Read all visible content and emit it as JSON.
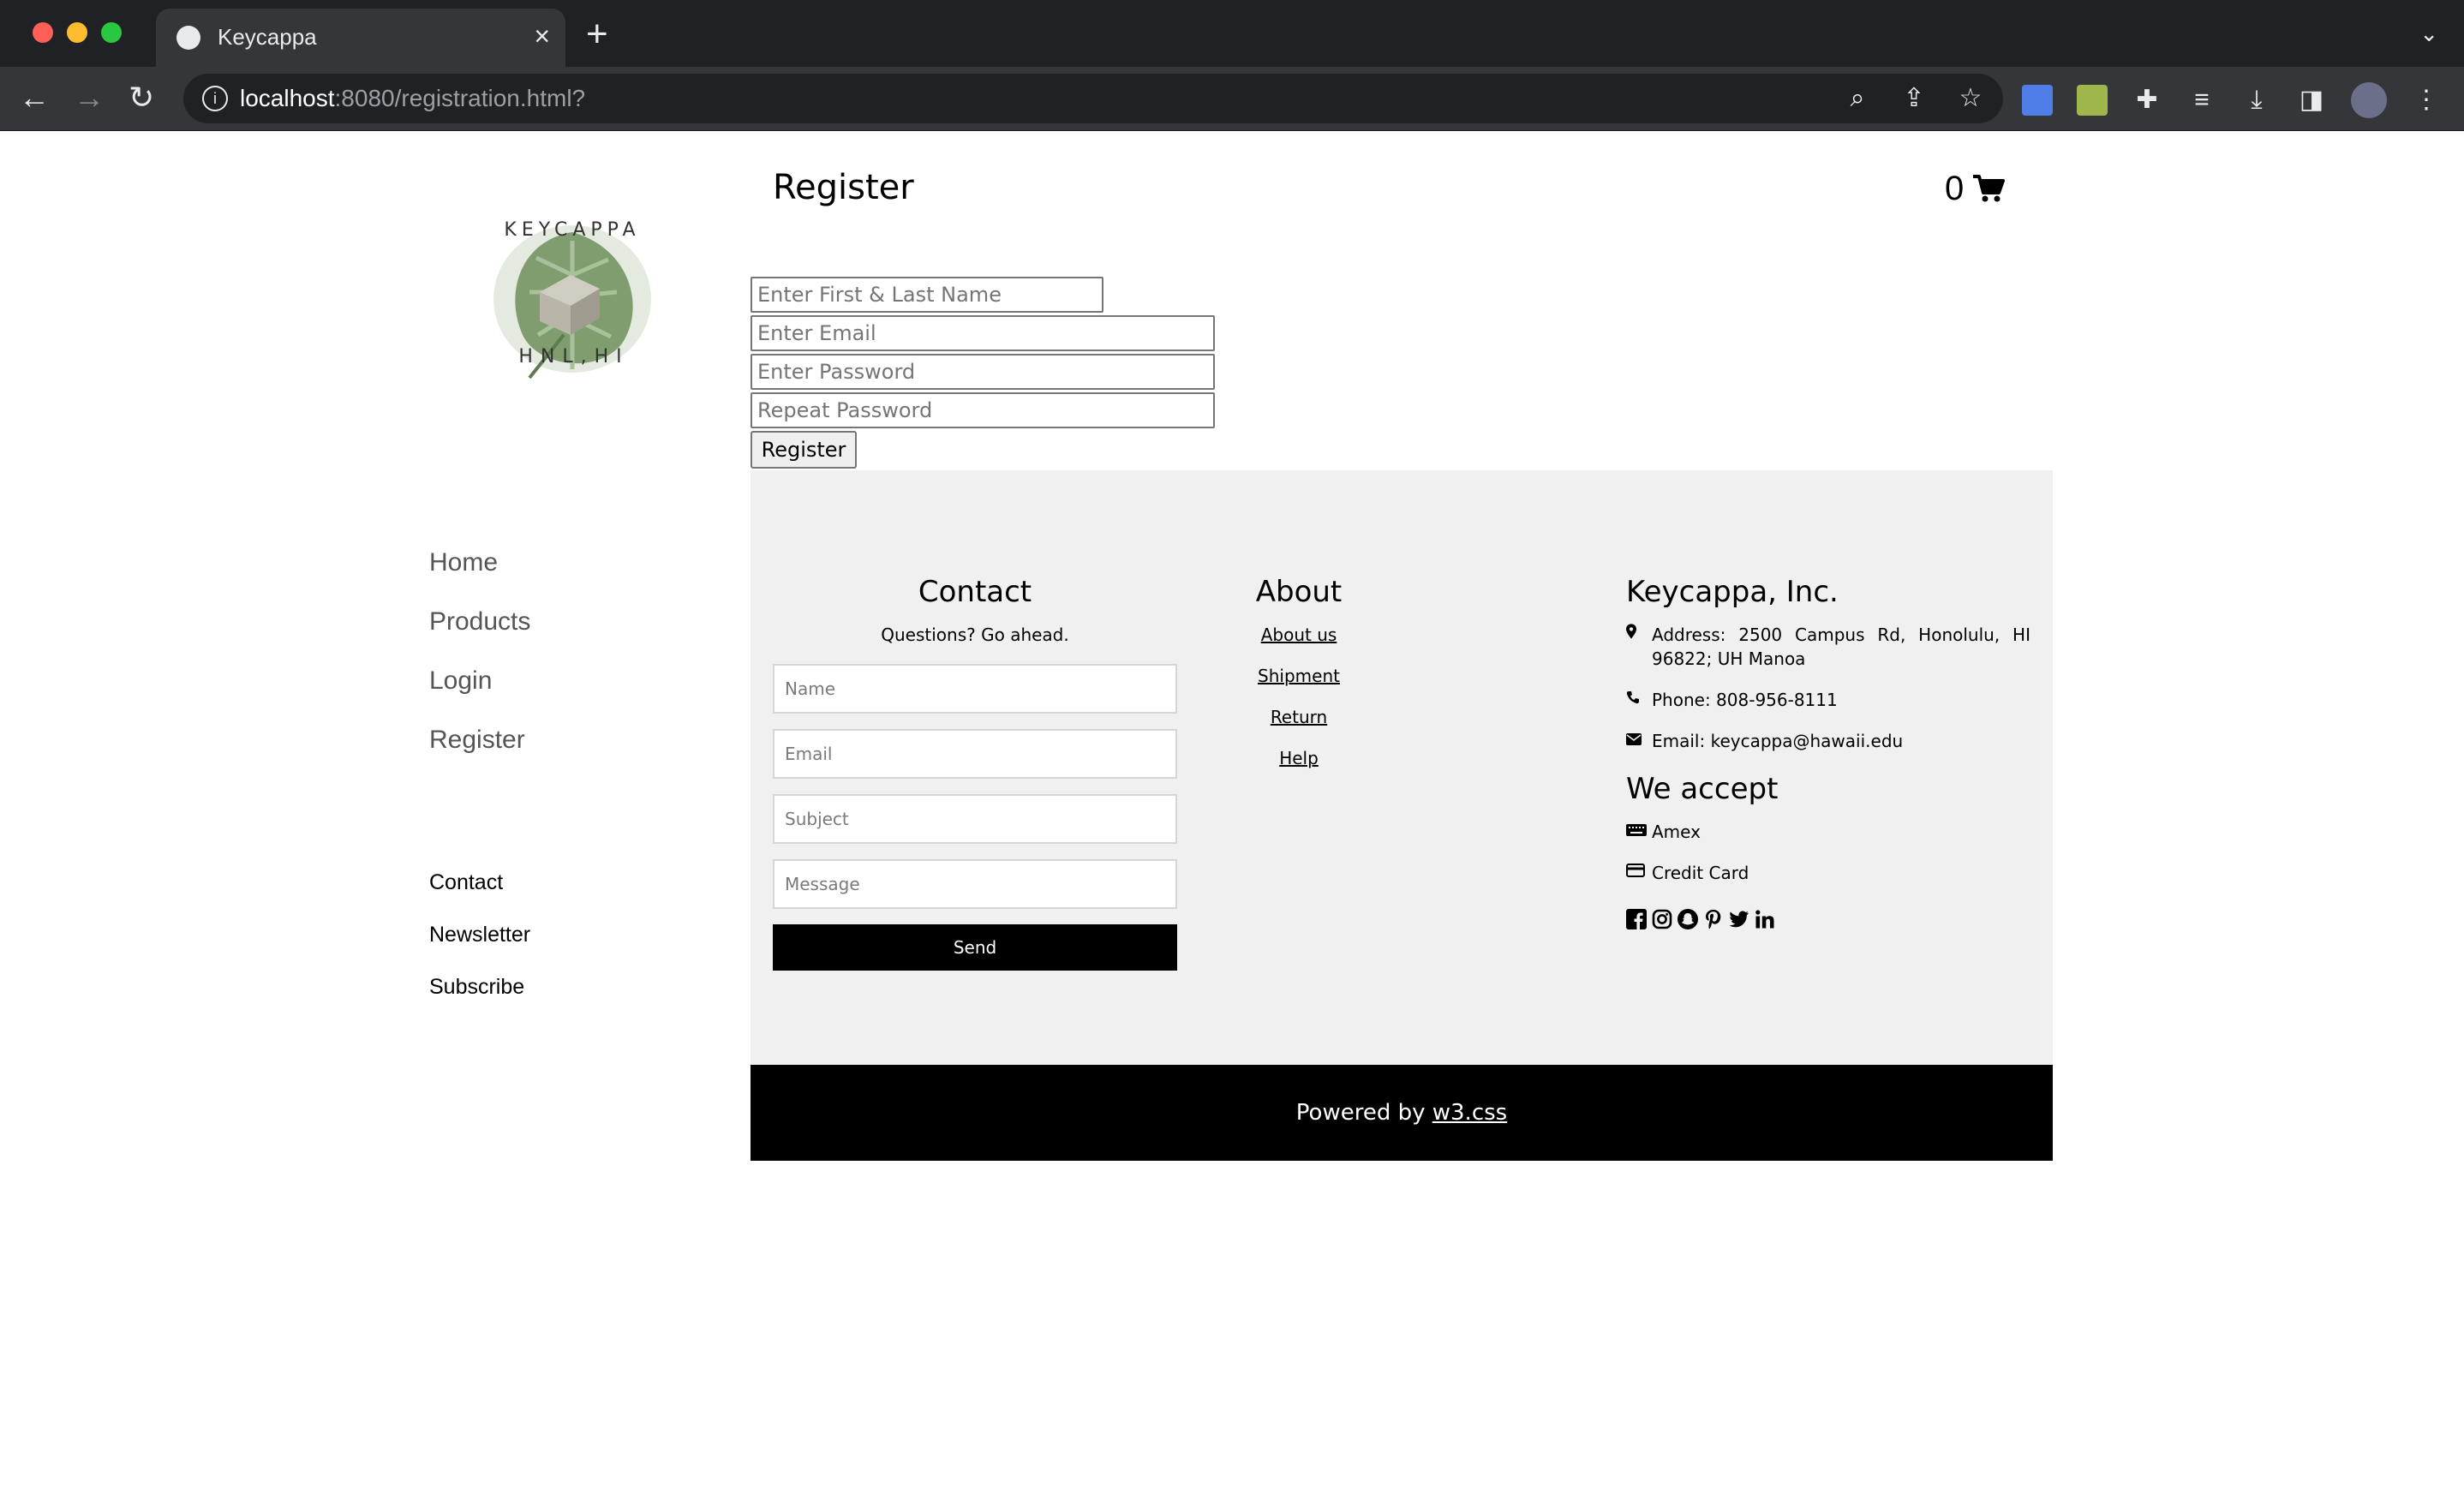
{
  "browser": {
    "tab_title": "Keycappa",
    "url_host": "localhost",
    "url_rest": ":8080/registration.html?"
  },
  "logo": {
    "top_text": "KEYCAPPA",
    "bottom_text": "HNL,HI"
  },
  "sidebar": {
    "nav": [
      {
        "label": "Home"
      },
      {
        "label": "Products"
      },
      {
        "label": "Login"
      },
      {
        "label": "Register"
      }
    ],
    "secondary": [
      {
        "label": "Contact"
      },
      {
        "label": "Newsletter"
      },
      {
        "label": "Subscribe"
      }
    ]
  },
  "header": {
    "title": "Register",
    "cart_count": "0"
  },
  "register_form": {
    "name_placeholder": "Enter First & Last Name",
    "email_placeholder": "Enter Email",
    "password_placeholder": "Enter Password",
    "repeat_placeholder": "Repeat Password",
    "submit_label": "Register"
  },
  "footer": {
    "contact": {
      "heading": "Contact",
      "subtitle": "Questions? Go ahead.",
      "name_placeholder": "Name",
      "email_placeholder": "Email",
      "subject_placeholder": "Subject",
      "message_placeholder": "Message",
      "send_label": "Send"
    },
    "about": {
      "heading": "About",
      "links": [
        {
          "label": "About us"
        },
        {
          "label": "Shipment"
        },
        {
          "label": "Return"
        },
        {
          "label": "Help"
        }
      ]
    },
    "company": {
      "heading": "Keycappa, Inc.",
      "address": "Address: 2500 Campus Rd, Honolulu, HI 96822; UH Manoa",
      "phone": "Phone: 808-956-8111",
      "email": "Email: keycappa@hawaii.edu",
      "accept_heading": "We accept",
      "payments": [
        {
          "label": "Amex",
          "icon": "keyboard-icon"
        },
        {
          "label": "Credit Card",
          "icon": "credit-card-icon"
        }
      ],
      "social_icons": [
        "facebook-icon",
        "instagram-icon",
        "snapchat-icon",
        "pinterest-icon",
        "twitter-icon",
        "linkedin-icon"
      ]
    },
    "powered_prefix": "Powered by ",
    "powered_link": "w3.css"
  }
}
